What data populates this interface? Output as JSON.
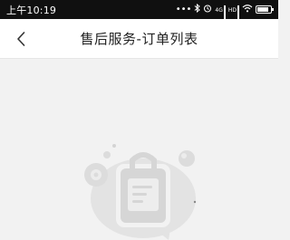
{
  "status_bar": {
    "time": "上午10:19",
    "icons": [
      "more-dots-icon",
      "bluetooth-icon",
      "alarm-icon",
      "signal-icon",
      "signal-icon",
      "wifi-icon",
      "battery-icon"
    ]
  },
  "nav": {
    "back_icon": "chevron-left-icon",
    "title": "售后服务-订单列表"
  },
  "empty_state": {
    "illustration": "empty-clipboard-illustration"
  },
  "colors": {
    "status_bar_bg": "#101010",
    "nav_bg": "#ffffff",
    "page_bg": "#f2f2f2",
    "illustration": "#dcdcdc"
  }
}
